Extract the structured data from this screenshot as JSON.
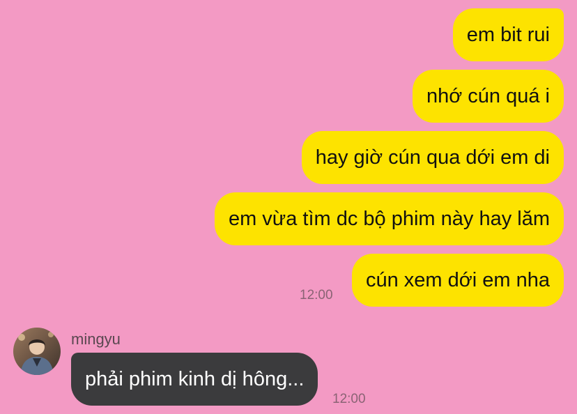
{
  "chat": {
    "outgoing": [
      {
        "text": "em bit rui"
      },
      {
        "text": "nhớ cún quá i"
      },
      {
        "text": "hay giờ cún qua dới em di"
      },
      {
        "text": "em vừa tìm dc bộ phim này hay lăm"
      },
      {
        "text": "cún xem dới em nha"
      }
    ],
    "outgoing_time": "12:00",
    "incoming": {
      "sender": "mingyu",
      "text": "phải phim kinh dị hông...",
      "time": "12:00"
    }
  },
  "colors": {
    "background": "#f39ac4",
    "outgoing_bubble": "#fde300",
    "incoming_bubble": "#3b3b3d"
  }
}
